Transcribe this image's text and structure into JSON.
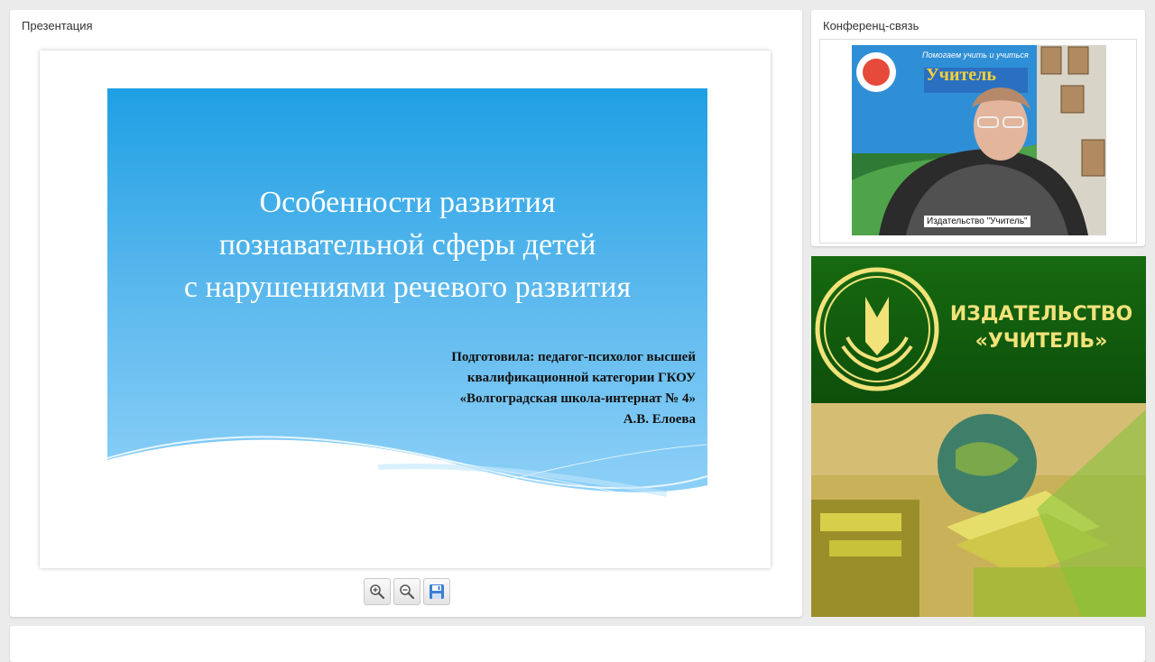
{
  "presentation_panel": {
    "title": "Презентация",
    "slide": {
      "title_lines": [
        "Особенности развития",
        "познавательной сферы детей",
        "с нарушениями речевого развития"
      ],
      "author_lines": [
        "Подготовила: педагог-психолог высшей",
        "квалификационной категории ГКОУ",
        "«Волгоградская школа-интернат № 4»",
        "А.В. Елоева"
      ]
    },
    "toolbar": [
      {
        "name": "zoom-in-icon"
      },
      {
        "name": "zoom-out-icon"
      },
      {
        "name": "save-icon"
      }
    ]
  },
  "conference_panel": {
    "title": "Конференц-связь",
    "video_caption": "Издательство \"Учитель\"",
    "backdrop_lines": [
      "Помогаем учить и учиться",
      "Учитель"
    ]
  },
  "publisher_banner": {
    "line1": "ИЗДАТЕЛЬСТВО",
    "line2": "«УЧИТЕЛЬ»"
  },
  "colors": {
    "slide_gradient_top": "#1ea0e4",
    "slide_gradient_bottom": "#8fd1f8",
    "banner_green": "#10580d",
    "logo_yellow": "#f2e27a"
  }
}
